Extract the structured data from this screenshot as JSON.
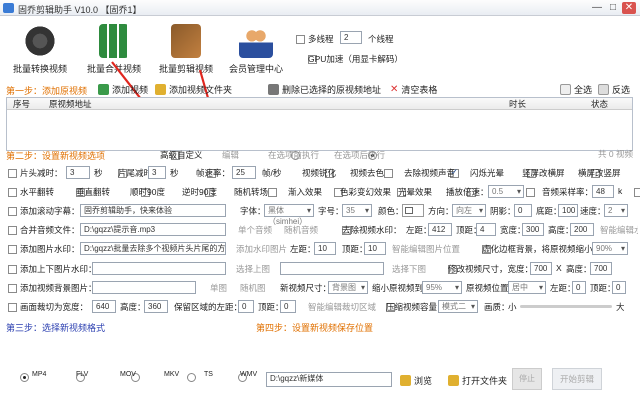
{
  "window": {
    "title": "固乔剪辑助手 V10.0  【固乔1】",
    "controls": [
      "—",
      "□",
      "✕"
    ]
  },
  "top_buttons": [
    {
      "label": "批量转换视频"
    },
    {
      "label": "批量合并视频"
    },
    {
      "label": "批量剪辑视频"
    },
    {
      "label": "会员管理中心"
    }
  ],
  "top_options": {
    "multithread_label": "多线程",
    "threads_value": "2",
    "threads_suffix": "个线程",
    "gpu_label": "GPU加速（用显卡解码）"
  },
  "step1": {
    "title": "第一步：添加原视频",
    "add_video": "添加视频",
    "add_video_folder": "添加视频文件夹",
    "delete_selected": "删除已选择的原视频地址",
    "clear_table": "清空表格",
    "select_all": "全选",
    "invert": "反选",
    "table_headers": [
      "序号",
      "原视频地址",
      "时长",
      "状态"
    ],
    "count_label": "共 0 视频"
  },
  "step2": {
    "title": "第二步：设置新视频选项",
    "advanced": "高级自定义",
    "edit": "编辑",
    "before": "在选项前执行",
    "after": "在选项后执行",
    "count_label": "共 0 视频",
    "row1": {
      "cut_head": "片头减时：",
      "cut_head_val": "3",
      "sec1": "秒",
      "cut_tail": "片尾减时：",
      "cut_tail_val": "3",
      "sec2": "秒",
      "fps": "帧速率：",
      "fps_val": "25",
      "fps_unit": "帧/秒",
      "sharpen": "视频锐化",
      "decolor": "视频去色",
      "remove_audio": "去除视频声音",
      "flash": "闪烁光晕",
      "vsplit": "竖屏改横屏",
      "hsplit": "横屏改竖屏"
    },
    "row2": {
      "hflip": "水平翻转",
      "vflip": "垂直翻转",
      "rot_cw": "顺时90度",
      "rot_ccw": "逆时90度",
      "random_transition": "随机转场",
      "fade_in": "渐入效果",
      "color_change": "色彩变幻效果",
      "light": "光晕效果",
      "speed_label": "播放倍速：",
      "speed_val": "0.5",
      "sample_rate": "音频采样率：",
      "sample_val": "48",
      "k": "k"
    },
    "row3": {
      "scroll_subtitle": "添加滚动字幕：",
      "subtitle_val": "固乔剪辑助手，快来体验",
      "font": "字体：",
      "font_val": "黑体（simhei）",
      "size": "字号：",
      "size_val": "35",
      "color": "颜色：",
      "direction": "方向：",
      "direction_val": "向左",
      "shadow": "阴影：",
      "shadow_val": "0",
      "bottom": "底距：",
      "bottom_val": "100",
      "speed": "速度：",
      "speed_val": "2"
    },
    "row4": {
      "merge_audio": "合并音频文件：",
      "audio_val": "D:\\gqzz\\提示音.mp3",
      "single_audio": "单个音频",
      "random_audio": "随机音频",
      "remove_wm": "去除视频水印：",
      "left": "左距：",
      "left_val": "412",
      "top": "顶距：",
      "top_val": "4",
      "width": "宽度：",
      "width_val": "300",
      "height": "高度：",
      "height_val": "200",
      "smart_wm": "智能编辑水印位置"
    },
    "row5": {
      "add_wm": "添加图片水印：",
      "wm_val": "D:\\gqzz\\批量去除多个视频片头片尾的方法",
      "add_wm_img": "添加水印图片",
      "left": "左距：",
      "left_val": "10",
      "top": "顶距：",
      "top_val": "10",
      "smart": "智能编辑图片位置",
      "blur_bg": "虚化边框背景，将原视频缩小到：",
      "blur_val": "90%"
    },
    "row6": {
      "add_top_bottom": "添加上下图片水印：",
      "top_img": "选择上图",
      "bottom_img": "选择下图",
      "change_size": "修改视频尺寸，宽度：",
      "w_val": "700",
      "x": "X",
      "h_label": "高度：",
      "h_val": "700"
    },
    "row7": {
      "add_bg": "添加视频背景图片：",
      "single_img": "单图",
      "random_img": "随机图",
      "new_size": "新视频尺寸：",
      "bg_val": "背景图",
      "shrink": "缩小原视频到：",
      "shrink_val": "95%",
      "pos": "原视频位置：",
      "pos_val": "居中",
      "left": "左距：",
      "left_val": "0",
      "top": "顶距：",
      "top_val": "0"
    },
    "row8": {
      "crop": "画面裁切为宽度：",
      "crop_w": "640",
      "crop_h_label": "高度：",
      "crop_h": "360",
      "keep_left": "保留区域的左距：",
      "left_val": "0",
      "top": "顶距：",
      "top_val": "0",
      "smart_crop": "智能编辑裁切区域",
      "compress": "压缩视频容量",
      "mode_val": "模式二",
      "size_label": "画质：",
      "small": "小",
      "big": "大"
    }
  },
  "step3": {
    "title": "第三步：选择新视频格式",
    "formats": [
      "MP4",
      "FLV",
      "MOV",
      "MKV",
      "TS",
      "WMV"
    ],
    "selected": 0
  },
  "step4": {
    "title": "第四步：设置新视频保存位置",
    "path": "D:\\gqzz\\新媒体",
    "browse": "浏览",
    "open_folder": "打开文件夹",
    "stop": "停止",
    "start": "开始剪辑"
  },
  "colors": {
    "step_title": "#e07000",
    "step_title_blue": "#2b3fb0",
    "arrow": "#e0261e"
  }
}
